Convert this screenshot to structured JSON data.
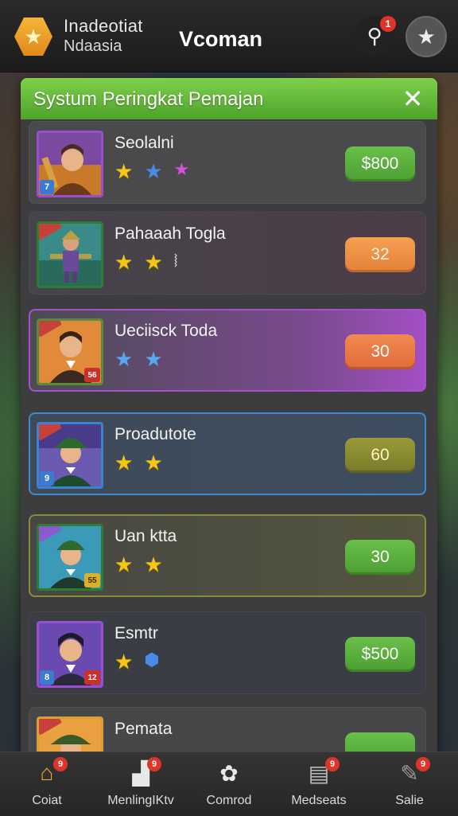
{
  "header": {
    "brand_line1": "Inadeotiat",
    "brand_line2": "Ndaasia",
    "app_title": "Vcoman",
    "logo_icon": "star-hexagon-icon",
    "link_icon": "link-icon",
    "link_badge": "1",
    "star_icon": "star-icon"
  },
  "panel": {
    "title": "Systum Peringkat Pemajan",
    "close_glyph": "✕"
  },
  "players": [
    {
      "name": "Seolalni",
      "value": "$800",
      "value_style": "green",
      "level": "7",
      "rank": "",
      "stars": [
        "gold",
        "blue",
        "pink"
      ]
    },
    {
      "name": "Pahaaah Togla",
      "value": "32",
      "value_style": "orange",
      "level": "",
      "rank": "",
      "stars": [
        "gold",
        "gold",
        "clip"
      ]
    },
    {
      "name": "Ueciisck Toda",
      "value": "30",
      "value_style": "red",
      "level": "",
      "rank": "56",
      "stars": [
        "lblue",
        "lblue"
      ]
    },
    {
      "name": "Proadutote",
      "value": "60",
      "value_style": "olive",
      "level": "9",
      "rank": "",
      "stars": [
        "gold",
        "gold"
      ]
    },
    {
      "name": "Uan ktta",
      "value": "30",
      "value_style": "green",
      "level": "",
      "rank": "55",
      "stars": [
        "gold",
        "gold"
      ]
    },
    {
      "name": "Esmtr",
      "value": "$500",
      "value_style": "green",
      "level": "8",
      "rank": "12",
      "stars": [
        "gold",
        "shield"
      ]
    },
    {
      "name": "Pemata",
      "value": "",
      "value_style": "green",
      "level": "",
      "rank": "",
      "stars": []
    }
  ],
  "nav": [
    {
      "label": "Coiat",
      "icon": "home-icon",
      "badge": "9"
    },
    {
      "label": "MenlingIKtv",
      "icon": "chart-icon",
      "badge": "9"
    },
    {
      "label": "Comrod",
      "icon": "paw-icon",
      "badge": ""
    },
    {
      "label": "Medseats",
      "icon": "cards-icon",
      "badge": "9"
    },
    {
      "label": "Salie",
      "icon": "sale-icon",
      "badge": "9"
    }
  ],
  "colors": {
    "header_green": "#5fb535",
    "badge_green": "#5aae3e",
    "badge_orange": "#ee8e45",
    "badge_red": "#e97845",
    "badge_olive": "#8a8a32",
    "notification_red": "#e0342a"
  }
}
